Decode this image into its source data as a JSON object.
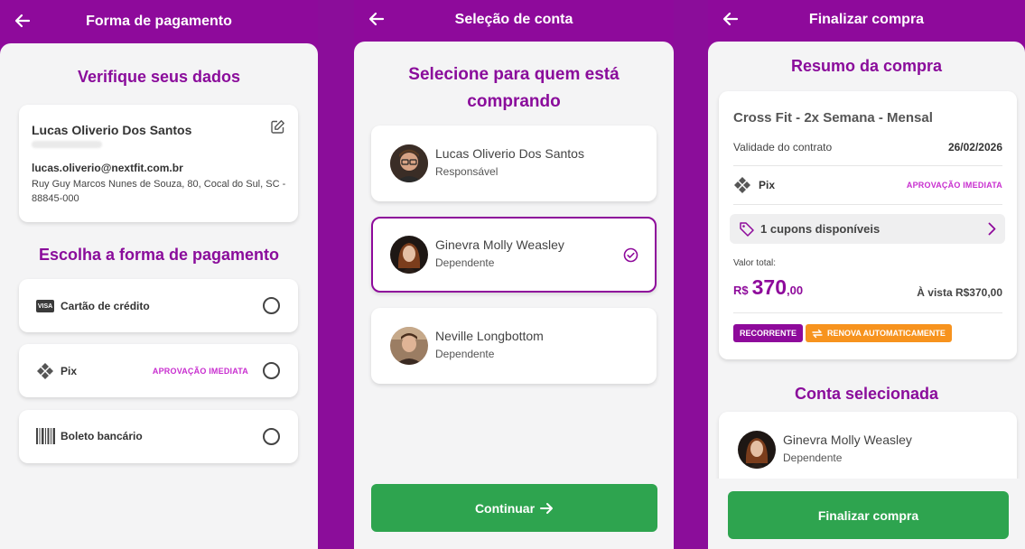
{
  "screen1": {
    "title": "Forma de pagamento",
    "verify_title": "Verifique seus dados",
    "user": {
      "name": "Lucas Oliverio Dos Santos",
      "email": "lucas.oliverio@nextfit.com.br",
      "address": "Ruy Guy Marcos Nunes de Souza, 80, Cocal do Sul, SC - 88845-000"
    },
    "choose_title": "Escolha a forma de pagamento",
    "options": [
      {
        "label": "Cartão de crédito",
        "icon": "visa-card-icon",
        "badge": ""
      },
      {
        "label": "Pix",
        "icon": "pix-icon",
        "badge": "APROVAÇÃO IMEDIATA"
      },
      {
        "label": "Boleto bancário",
        "icon": "barcode-icon",
        "badge": ""
      }
    ],
    "visa_text": "VISA"
  },
  "screen2": {
    "title": "Seleção de conta",
    "heading_line1": "Selecione para quem está",
    "heading_line2": "comprando",
    "accounts": [
      {
        "name": "Lucas Oliverio Dos Santos",
        "role": "Responsável",
        "selected": false
      },
      {
        "name": "Ginevra Molly Weasley",
        "role": "Dependente",
        "selected": true
      },
      {
        "name": "Neville Longbottom",
        "role": "Dependente",
        "selected": false
      }
    ],
    "continue_label": "Continuar"
  },
  "screen3": {
    "title": "Finalizar compra",
    "summary_title": "Resumo da compra",
    "plan_name": "Cross Fit - 2x Semana - Mensal",
    "validity_label": "Validade do contrato",
    "validity_value": "26/02/2026",
    "payment_method": "Pix",
    "payment_badge": "APROVAÇÃO IMEDIATA",
    "coupons_label": "1 cupons disponíveis",
    "total_label": "Valor total:",
    "price_currency": "R$",
    "price_int": "370",
    "price_dec": ",00",
    "cash_price": "À vista R$370,00",
    "tag_recurring": "RECORRENTE",
    "tag_auto_renew": "RENOVA AUTOMATICAMENTE",
    "selected_account_title": "Conta selecionada",
    "selected_account": {
      "name": "Ginevra Molly Weasley",
      "role": "Dependente"
    },
    "finish_label": "Finalizar compra"
  },
  "colors": {
    "brand_purple": "#8e0a9b",
    "accent_pink": "#c82ecf",
    "success_green": "#2ea44f",
    "warning_orange": "#f7931e"
  }
}
